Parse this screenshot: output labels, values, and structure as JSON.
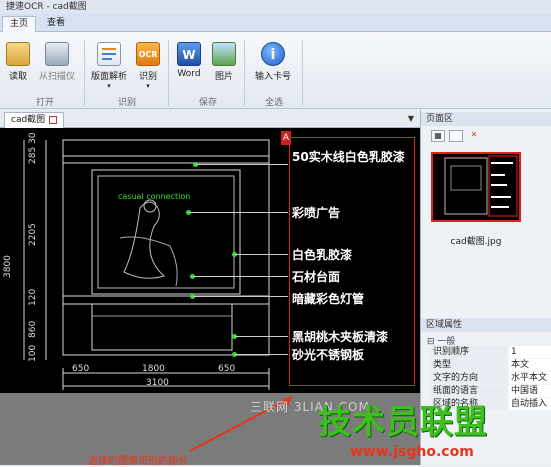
{
  "window": {
    "title": "捷速OCR - cad截图"
  },
  "tabs": [
    {
      "label": "主页"
    },
    {
      "label": "查看"
    }
  ],
  "ribbon": {
    "groups": [
      {
        "label": "打开"
      },
      {
        "label": "识别"
      },
      {
        "label": "保存"
      },
      {
        "label": "全选"
      }
    ],
    "buttons": {
      "read": "读取",
      "scan": "从扫描仪",
      "layout": "版面解析",
      "recognize": "识别",
      "word": "Word",
      "image": "图片",
      "serial": "输入卡号"
    },
    "icon_texts": {
      "ocr": "OCR",
      "word": "W"
    }
  },
  "document_tab": {
    "label": "cad截图"
  },
  "cad": {
    "annotations": [
      "50实木线白色乳胶漆",
      "彩喷广告",
      "白色乳胶漆",
      "石材台面",
      "暗藏彩色灯管",
      "黑胡桃木夹板清漆",
      "砂光不锈钢板"
    ],
    "dims_vertical": [
      "3800",
      "285",
      "30",
      "2205",
      "120",
      "860",
      "100"
    ],
    "dims_horizontal": [
      "650",
      "1800",
      "650",
      "3100"
    ],
    "poster_text": "casual connection",
    "marker": "A"
  },
  "right_panel": {
    "pages_header": "页面区",
    "thumbnail_name": "cad截图.jpg",
    "props_header": "区域属性",
    "props_section": "一般",
    "properties": [
      {
        "key": "识别顺序",
        "value": "1"
      },
      {
        "key": "类型",
        "value": "本文"
      },
      {
        "key": "文字的方向",
        "value": "水平本文"
      },
      {
        "key": "纸面的语言",
        "value": "中国语"
      },
      {
        "key": "区域的名称",
        "value": "自动插入"
      }
    ]
  },
  "watermarks": {
    "site_cn": "三联网 3LIAN.COM",
    "brand": "技术员联盟",
    "url": "www.jsgho.com"
  },
  "caption": "选择的图像识别的部分"
}
